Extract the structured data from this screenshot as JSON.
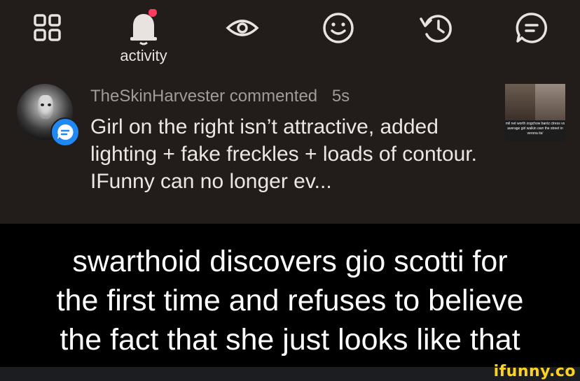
{
  "tabbar": {
    "active_tab_label": "activity",
    "notification_dot_color": "#ff3b5c"
  },
  "activity": {
    "username": "TheSkinHarvester",
    "action": "commented",
    "time": "5s",
    "comment_text": "Girl on the right isn’t attractive, added lighting + fake freckles + loads of contour. IFunny can no longer ev...",
    "thumbnail_caption": "mil net worth zogchow bantz ctress vs average girl walkin own the street in verona ita'",
    "badge_color": "#1e88f5"
  },
  "caption": {
    "line1": "swarthoid discovers gio scotti for",
    "line2": "the first time and refuses to believe",
    "line3": "the fact that she just looks like that"
  },
  "watermark": {
    "text": "ifunny.co",
    "color": "#ffd21e"
  }
}
